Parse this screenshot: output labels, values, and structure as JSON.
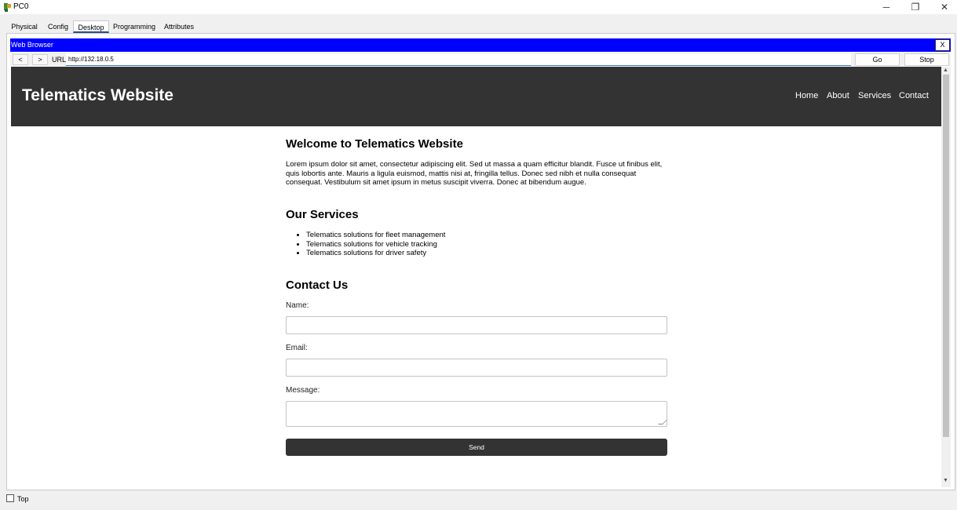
{
  "window": {
    "title": "PC0",
    "minimize": "─",
    "restore": "❐",
    "close": "✕"
  },
  "tabs": [
    {
      "label": "Physical",
      "active": false
    },
    {
      "label": "Config",
      "active": false
    },
    {
      "label": "Desktop",
      "active": true
    },
    {
      "label": "Programming",
      "active": false
    },
    {
      "label": "Attributes",
      "active": false
    }
  ],
  "browser": {
    "title": "Web Browser",
    "close_label": "X",
    "back_label": "<",
    "forward_label": ">",
    "url_label": "URL",
    "url_value": "http://132.18.0.5",
    "go_label": "Go",
    "stop_label": "Stop",
    "header_color": "#0000ff"
  },
  "site": {
    "title": "Telematics Website",
    "nav": [
      "Home",
      "About",
      "Services",
      "Contact"
    ],
    "header_color": "#333333",
    "welcome_heading": "Welcome to Telematics Website",
    "welcome_text": "Lorem ipsum dolor sit amet, consectetur adipiscing elit. Sed ut massa a quam efficitur blandit. Fusce ut finibus elit, quis lobortis ante. Mauris a ligula euismod, mattis nisi at, fringilla tellus. Donec sed nibh et nulla consequat consequat. Vestibulum sit amet ipsum in metus suscipit viverra. Donec at bibendum augue.",
    "services_heading": "Our Services",
    "services": [
      "Telematics solutions for fleet management",
      "Telematics solutions for vehicle tracking",
      "Telematics solutions for driver safety"
    ],
    "contact_heading": "Contact Us",
    "name_label": "Name:",
    "email_label": "Email:",
    "message_label": "Message:",
    "send_label": "Send"
  },
  "footer": {
    "top_label": "Top",
    "top_checked": false
  }
}
